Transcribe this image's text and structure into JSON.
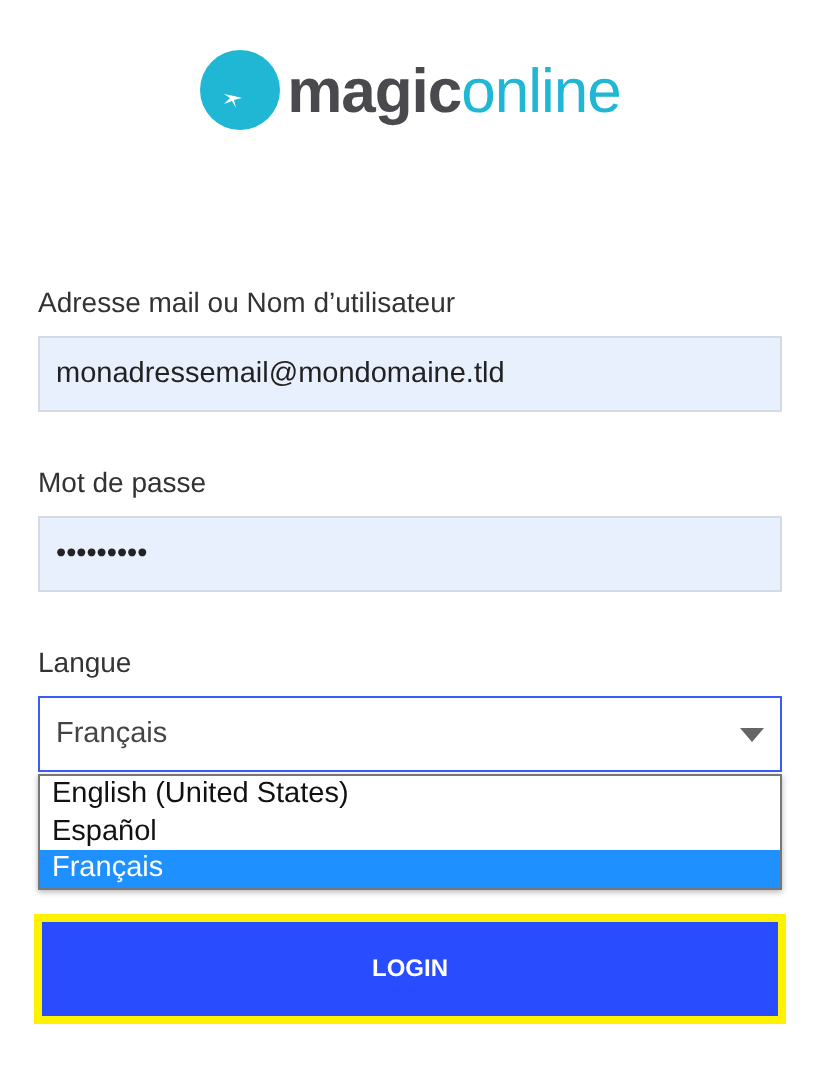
{
  "logo": {
    "name_part_1": "magic",
    "name_part_2": "online"
  },
  "fields": [
    {
      "label": "Adresse mail ou Nom d’utilisateur",
      "value": "monadressemail@mondomaine.tld"
    },
    {
      "label": "Mot de passe",
      "value": "•••••••••"
    }
  ],
  "language": {
    "label": "Langue",
    "value": "Français",
    "expanded": true,
    "options": [
      {
        "label": "English (United States)",
        "selected": false
      },
      {
        "label": "Español",
        "selected": false
      },
      {
        "label": "Français",
        "selected": true
      }
    ]
  },
  "login_button": {
    "label": "LOGIN",
    "focused": true
  }
}
